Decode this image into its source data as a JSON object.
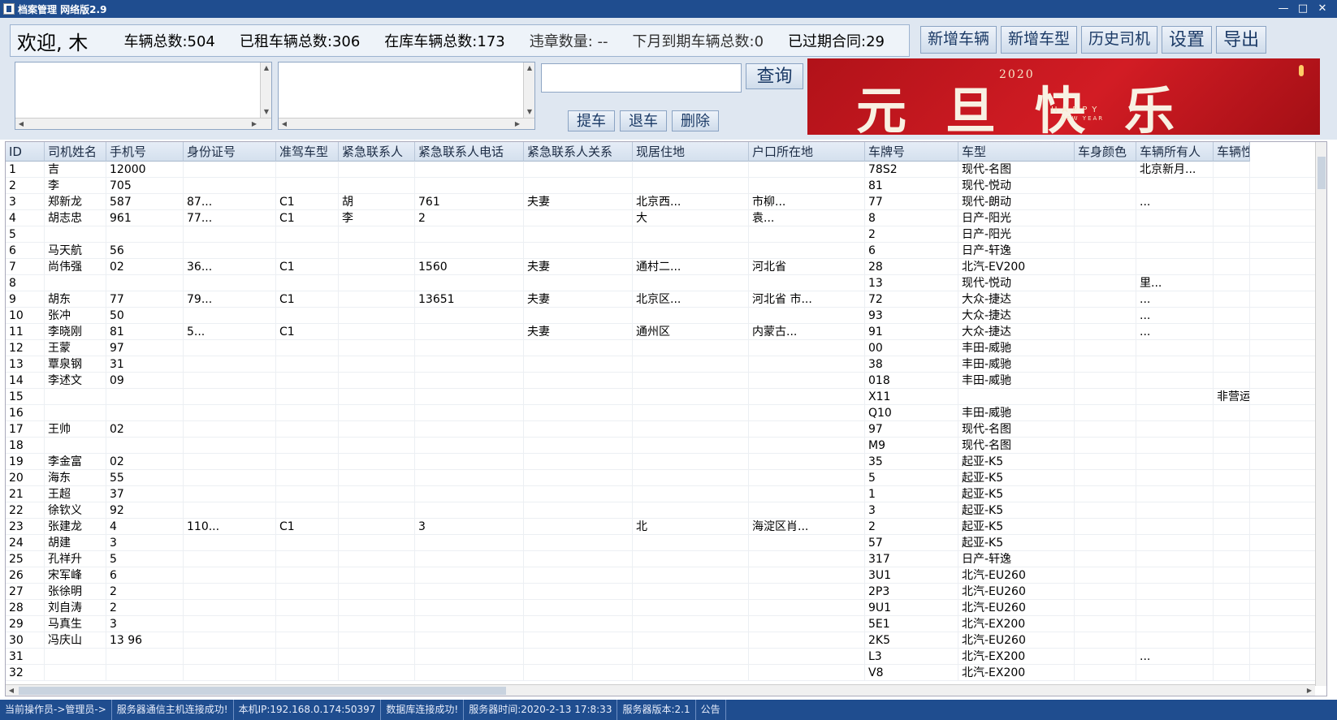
{
  "window": {
    "title": "档案管理 网络版2.9",
    "min": "—",
    "max": "□",
    "close": "✕"
  },
  "stats": {
    "welcome": "欢迎, 木",
    "total_vehicles": "车辆总数:504",
    "rented_vehicles": "已租车辆总数:306",
    "in_stock_vehicles": "在库车辆总数:173",
    "violations": "违章数量: --",
    "expiring_next_month": "下月到期车辆总数:0",
    "expired_contracts": "已过期合同:29"
  },
  "actions": {
    "add_vehicle": "新增车辆",
    "add_model": "新增车型",
    "history_drivers": "历史司机",
    "settings": "设置",
    "export": "导出"
  },
  "search": {
    "value": "",
    "query_label": "查询"
  },
  "ops": {
    "pickup": "提车",
    "return": "退车",
    "delete": "删除"
  },
  "banner": {
    "year": "2020",
    "text": "元旦快乐",
    "happy": "HAPPY",
    "new_year": "NEW YEAR"
  },
  "columns": [
    "ID",
    "司机姓名",
    "手机号",
    "身份证号",
    "准驾车型",
    "紧急联系人",
    "紧急联系人电话",
    "紧急联系人关系",
    "现居住地",
    "户口所在地",
    "车牌号",
    "车型",
    "车身颜色",
    "车辆所有人",
    "车辆性"
  ],
  "rows": [
    {
      "id": "1",
      "name": "吉",
      "phone": "12000",
      "idcard": "",
      "license": "",
      "ec": "",
      "ecphone": "",
      "ecrel": "",
      "addr": "",
      "hukou": "",
      "plate": "78S2",
      "model": "现代-名图",
      "color": "",
      "owner": "北京新月...",
      "nature": ""
    },
    {
      "id": "2",
      "name": "李",
      "phone": "705",
      "idcard": "",
      "license": "",
      "ec": "",
      "ecphone": "",
      "ecrel": "",
      "addr": "",
      "hukou": "",
      "plate": "81",
      "model": "现代-悦动",
      "color": "",
      "owner": "",
      "nature": ""
    },
    {
      "id": "3",
      "name": "郑新龙",
      "phone": "587",
      "idcard": "87...",
      "license": "C1",
      "ec": "胡",
      "ecphone": "761",
      "ecrel": "夫妻",
      "addr": "北京西...",
      "hukou": "市柳...",
      "plate": "77",
      "model": "现代-朗动",
      "color": "",
      "owner": "...",
      "nature": ""
    },
    {
      "id": "4",
      "name": "胡志忠",
      "phone": "961",
      "idcard": "77...",
      "license": "C1",
      "ec": "李",
      "ecphone": "2",
      "ecrel": "",
      "addr": "大",
      "hukou": "袁...",
      "plate": "8",
      "model": "日产-阳光",
      "color": "",
      "owner": "",
      "nature": ""
    },
    {
      "id": "5",
      "name": "",
      "phone": "",
      "idcard": "",
      "license": "",
      "ec": "",
      "ecphone": "",
      "ecrel": "",
      "addr": "",
      "hukou": "",
      "plate": "2",
      "model": "日产-阳光",
      "color": "",
      "owner": "",
      "nature": ""
    },
    {
      "id": "6",
      "name": "马天航",
      "phone": "56",
      "idcard": "",
      "license": "",
      "ec": "",
      "ecphone": "",
      "ecrel": "",
      "addr": "",
      "hukou": "",
      "plate": "6",
      "model": "日产-轩逸",
      "color": "",
      "owner": "",
      "nature": ""
    },
    {
      "id": "7",
      "name": "尚伟强",
      "phone": "02",
      "idcard": "36...",
      "license": "C1",
      "ec": "",
      "ecphone": "1560",
      "ecrel": "夫妻",
      "addr": "通村二...",
      "hukou": "河北省",
      "plate": "28",
      "model": "北汽-EV200",
      "color": "",
      "owner": "",
      "nature": ""
    },
    {
      "id": "8",
      "name": "",
      "phone": "",
      "idcard": "",
      "license": "",
      "ec": "",
      "ecphone": "",
      "ecrel": "",
      "addr": "",
      "hukou": "",
      "plate": "13",
      "model": "现代-悦动",
      "color": "",
      "owner": "里...",
      "nature": ""
    },
    {
      "id": "9",
      "name": "胡东",
      "phone": "77",
      "idcard": "79...",
      "license": "C1",
      "ec": "",
      "ecphone": "13651",
      "ecrel": "夫妻",
      "addr": "北京区...",
      "hukou": "河北省 市...",
      "plate": "72",
      "model": "大众-捷达",
      "color": "",
      "owner": "...",
      "nature": ""
    },
    {
      "id": "10",
      "name": "张冲",
      "phone": "50",
      "idcard": "",
      "license": "",
      "ec": "",
      "ecphone": "",
      "ecrel": "",
      "addr": "",
      "hukou": "",
      "plate": "93",
      "model": "大众-捷达",
      "color": "",
      "owner": "...",
      "nature": ""
    },
    {
      "id": "11",
      "name": "李晓刚",
      "phone": "81",
      "idcard": "5...",
      "license": "C1",
      "ec": "",
      "ecphone": "",
      "ecrel": "夫妻",
      "addr": "通州区",
      "hukou": "内蒙古...",
      "plate": "91",
      "model": "大众-捷达",
      "color": "",
      "owner": "...",
      "nature": ""
    },
    {
      "id": "12",
      "name": "王蒙",
      "phone": "97",
      "idcard": "",
      "license": "",
      "ec": "",
      "ecphone": "",
      "ecrel": "",
      "addr": "",
      "hukou": "",
      "plate": "00",
      "model": "丰田-威驰",
      "color": "",
      "owner": "",
      "nature": ""
    },
    {
      "id": "13",
      "name": "覃泉钢",
      "phone": "31",
      "idcard": "",
      "license": "",
      "ec": "",
      "ecphone": "",
      "ecrel": "",
      "addr": "",
      "hukou": "",
      "plate": "38",
      "model": "丰田-威驰",
      "color": "",
      "owner": "",
      "nature": ""
    },
    {
      "id": "14",
      "name": "李述文",
      "phone": "09",
      "idcard": "",
      "license": "",
      "ec": "",
      "ecphone": "",
      "ecrel": "",
      "addr": "",
      "hukou": "",
      "plate": "018",
      "model": "丰田-威驰",
      "color": "",
      "owner": "",
      "nature": ""
    },
    {
      "id": "15",
      "name": "",
      "phone": "",
      "idcard": "",
      "license": "",
      "ec": "",
      "ecphone": "",
      "ecrel": "",
      "addr": "",
      "hukou": "",
      "plate": "X11",
      "model": "",
      "color": "",
      "owner": "",
      "nature": "非营运"
    },
    {
      "id": "16",
      "name": "",
      "phone": "",
      "idcard": "",
      "license": "",
      "ec": "",
      "ecphone": "",
      "ecrel": "",
      "addr": "",
      "hukou": "",
      "plate": "Q10",
      "model": "丰田-威驰",
      "color": "",
      "owner": "",
      "nature": ""
    },
    {
      "id": "17",
      "name": "王帅",
      "phone": "02",
      "idcard": "",
      "license": "",
      "ec": "",
      "ecphone": "",
      "ecrel": "",
      "addr": "",
      "hukou": "",
      "plate": "97",
      "model": "现代-名图",
      "color": "",
      "owner": "",
      "nature": ""
    },
    {
      "id": "18",
      "name": "",
      "phone": "",
      "idcard": "",
      "license": "",
      "ec": "",
      "ecphone": "",
      "ecrel": "",
      "addr": "",
      "hukou": "",
      "plate": "M9",
      "model": "现代-名图",
      "color": "",
      "owner": "",
      "nature": ""
    },
    {
      "id": "19",
      "name": "李金富",
      "phone": "02",
      "idcard": "",
      "license": "",
      "ec": "",
      "ecphone": "",
      "ecrel": "",
      "addr": "",
      "hukou": "",
      "plate": "35",
      "model": "起亚-K5",
      "color": "",
      "owner": "",
      "nature": ""
    },
    {
      "id": "20",
      "name": "海东",
      "phone": "55",
      "idcard": "",
      "license": "",
      "ec": "",
      "ecphone": "",
      "ecrel": "",
      "addr": "",
      "hukou": "",
      "plate": "5",
      "model": "起亚-K5",
      "color": "",
      "owner": "",
      "nature": ""
    },
    {
      "id": "21",
      "name": "王超",
      "phone": "37",
      "idcard": "",
      "license": "",
      "ec": "",
      "ecphone": "",
      "ecrel": "",
      "addr": "",
      "hukou": "",
      "plate": "1",
      "model": "起亚-K5",
      "color": "",
      "owner": "",
      "nature": ""
    },
    {
      "id": "22",
      "name": "徐钦义",
      "phone": "92",
      "idcard": "",
      "license": "",
      "ec": "",
      "ecphone": "",
      "ecrel": "",
      "addr": "",
      "hukou": "",
      "plate": "3",
      "model": "起亚-K5",
      "color": "",
      "owner": "",
      "nature": ""
    },
    {
      "id": "23",
      "name": "张建龙",
      "phone": "4",
      "idcard": "110...",
      "license": "C1",
      "ec": "",
      "ecphone": "3",
      "ecrel": "",
      "addr": "北",
      "hukou": "海淀区肖...",
      "plate": "2",
      "model": "起亚-K5",
      "color": "",
      "owner": "",
      "nature": ""
    },
    {
      "id": "24",
      "name": "胡建",
      "phone": "3",
      "idcard": "",
      "license": "",
      "ec": "",
      "ecphone": "",
      "ecrel": "",
      "addr": "",
      "hukou": "",
      "plate": "57",
      "model": "起亚-K5",
      "color": "",
      "owner": "",
      "nature": ""
    },
    {
      "id": "25",
      "name": "孔祥升",
      "phone": "5",
      "idcard": "",
      "license": "",
      "ec": "",
      "ecphone": "",
      "ecrel": "",
      "addr": "",
      "hukou": "",
      "plate": "317",
      "model": "日产-轩逸",
      "color": "",
      "owner": "",
      "nature": ""
    },
    {
      "id": "26",
      "name": "宋军峰",
      "phone": "6",
      "idcard": "",
      "license": "",
      "ec": "",
      "ecphone": "",
      "ecrel": "",
      "addr": "",
      "hukou": "",
      "plate": "3U1",
      "model": "北汽-EU260",
      "color": "",
      "owner": "",
      "nature": ""
    },
    {
      "id": "27",
      "name": "张徐明",
      "phone": "2",
      "idcard": "",
      "license": "",
      "ec": "",
      "ecphone": "",
      "ecrel": "",
      "addr": "",
      "hukou": "",
      "plate": "2P3",
      "model": "北汽-EU260",
      "color": "",
      "owner": "",
      "nature": ""
    },
    {
      "id": "28",
      "name": "刘自涛",
      "phone": "2",
      "idcard": "",
      "license": "",
      "ec": "",
      "ecphone": "",
      "ecrel": "",
      "addr": "",
      "hukou": "",
      "plate": "9U1",
      "model": "北汽-EU260",
      "color": "",
      "owner": "",
      "nature": ""
    },
    {
      "id": "29",
      "name": "马真生",
      "phone": "3",
      "idcard": "",
      "license": "",
      "ec": "",
      "ecphone": "",
      "ecrel": "",
      "addr": "",
      "hukou": "",
      "plate": "5E1",
      "model": "北汽-EX200",
      "color": "",
      "owner": "",
      "nature": ""
    },
    {
      "id": "30",
      "name": "冯庆山",
      "phone": "13 96",
      "idcard": "",
      "license": "",
      "ec": "",
      "ecphone": "",
      "ecrel": "",
      "addr": "",
      "hukou": "",
      "plate": "2K5",
      "model": "北汽-EU260",
      "color": "",
      "owner": "",
      "nature": ""
    },
    {
      "id": "31",
      "name": "",
      "phone": "",
      "idcard": "",
      "license": "",
      "ec": "",
      "ecphone": "",
      "ecrel": "",
      "addr": "",
      "hukou": "",
      "plate": "L3",
      "model": "北汽-EX200",
      "color": "",
      "owner": "...",
      "nature": ""
    },
    {
      "id": "32",
      "name": "",
      "phone": "",
      "idcard": "",
      "license": "",
      "ec": "",
      "ecphone": "",
      "ecrel": "",
      "addr": "",
      "hukou": "",
      "plate": "V8",
      "model": "北汽-EX200",
      "color": "",
      "owner": "",
      "nature": ""
    }
  ],
  "statusbar": {
    "operator": "当前操作员->管理员->",
    "server_comm": "服务器通信主机连接成功!",
    "local_ip": "本机IP:192.168.0.174:50397",
    "db": "数据库连接成功!",
    "server_time": "服务器时间:2020-2-13 17:8:33",
    "server_version": "服务器版本:2.1",
    "notice": "公告"
  }
}
